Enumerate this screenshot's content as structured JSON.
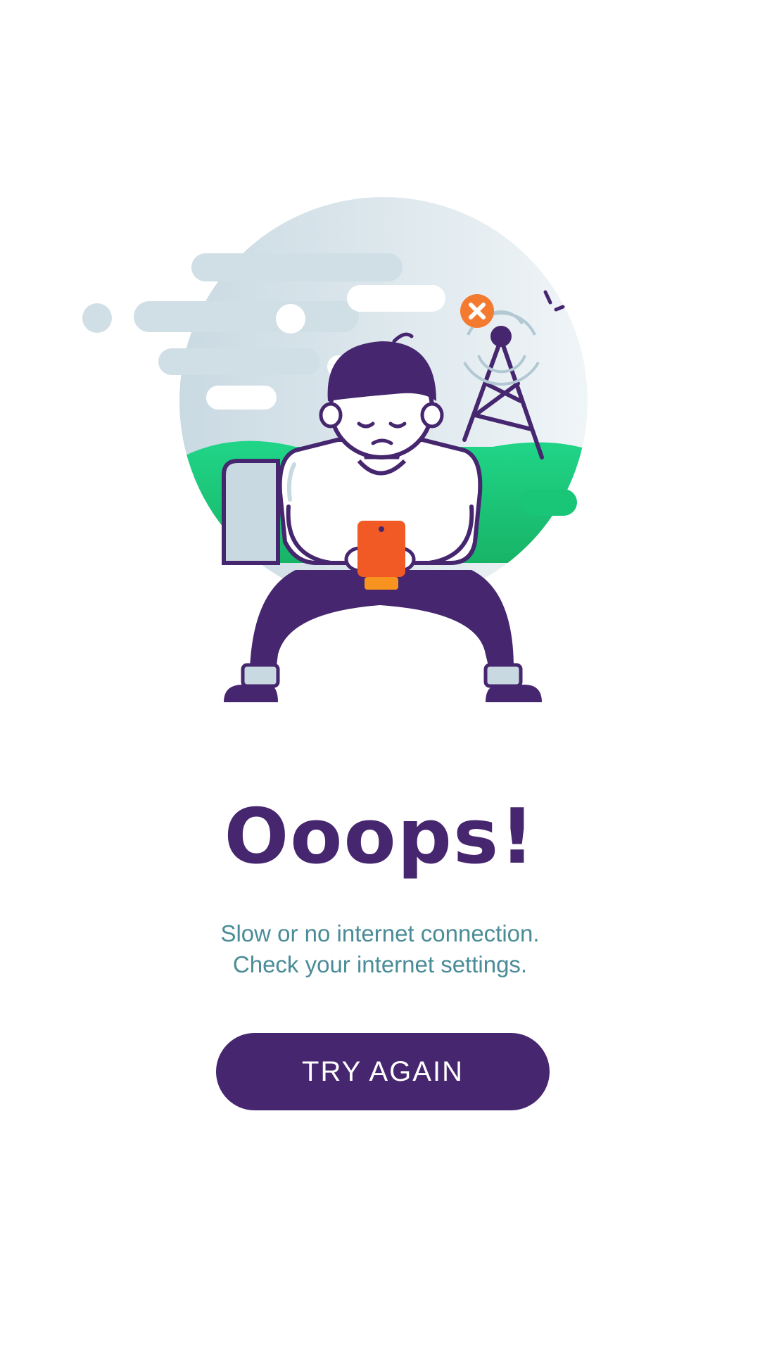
{
  "illustration": {
    "icon": "person-offline-icon",
    "colors": {
      "primary": "#46266e",
      "green": "#1ed47d",
      "orange": "#f15a24",
      "cloud": "#d2e0e8"
    }
  },
  "error": {
    "title": "Ooops!",
    "message_line1": "Slow or no internet connection.",
    "message_line2": "Check your internet settings."
  },
  "actions": {
    "retry_label": "TRY AGAIN"
  }
}
